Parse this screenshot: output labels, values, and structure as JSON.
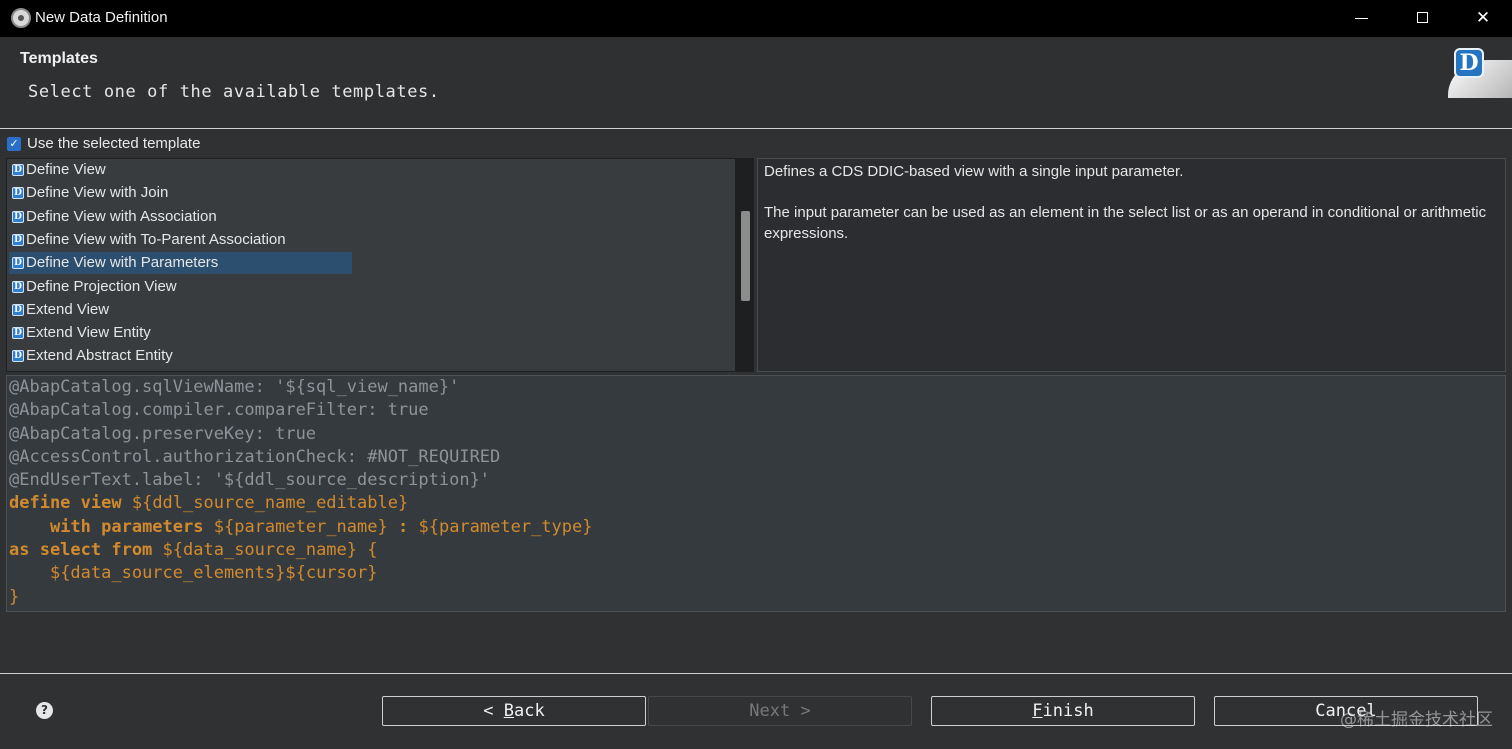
{
  "window": {
    "title": "New Data Definition"
  },
  "header": {
    "title": "Templates",
    "description": "Select one of the available templates."
  },
  "use_template": {
    "label": "Use the selected template",
    "checked": true
  },
  "templates": [
    {
      "label": "Define View"
    },
    {
      "label": "Define View with Join"
    },
    {
      "label": "Define View with Association"
    },
    {
      "label": "Define View with To-Parent Association"
    },
    {
      "label": "Define View with Parameters",
      "selected": true
    },
    {
      "label": "Define Projection View"
    },
    {
      "label": "Extend View"
    },
    {
      "label": "Extend View Entity"
    },
    {
      "label": "Extend Abstract Entity"
    }
  ],
  "description": {
    "p1": "Defines a CDS DDIC-based view with a single input parameter.",
    "p2": "The input parameter can be used as an element in the select list or as an operand in conditional or arithmetic expressions."
  },
  "code": {
    "l1": "@AbapCatalog.sqlViewName: '${sql_view_name}'",
    "l2": "@AbapCatalog.compiler.compareFilter: true",
    "l3": "@AbapCatalog.preserveKey: true",
    "l4": "@AccessControl.authorizationCheck: #NOT_REQUIRED",
    "l5": "@EndUserText.label: '${ddl_source_description}'",
    "define_view": "define view",
    "ddl_name": "${ddl_source_name_editable}",
    "with_parameters": "with parameters",
    "param_name": "${parameter_name}",
    "colon": ":",
    "param_type": "${parameter_type}",
    "as_select_from": "as select from",
    "ds_name": "${data_source_name}",
    "open_brace": "{",
    "ds_elements": "${data_source_elements}",
    "cursor": "${cursor}",
    "close_brace": "}"
  },
  "buttons": {
    "back_prefix": "< ",
    "back_mnemonic": "B",
    "back_rest": "ack",
    "next": "Next >",
    "finish_mnemonic": "F",
    "finish_rest": "inish",
    "cancel": "Cancel"
  },
  "help_icon": "help-icon",
  "watermark": "@稀土掘金技术社区",
  "colors": {
    "keyword": "#d28a2e",
    "annotation": "#8f9398",
    "selection": "#2c4f6f",
    "checkbox": "#2a6fc8"
  }
}
